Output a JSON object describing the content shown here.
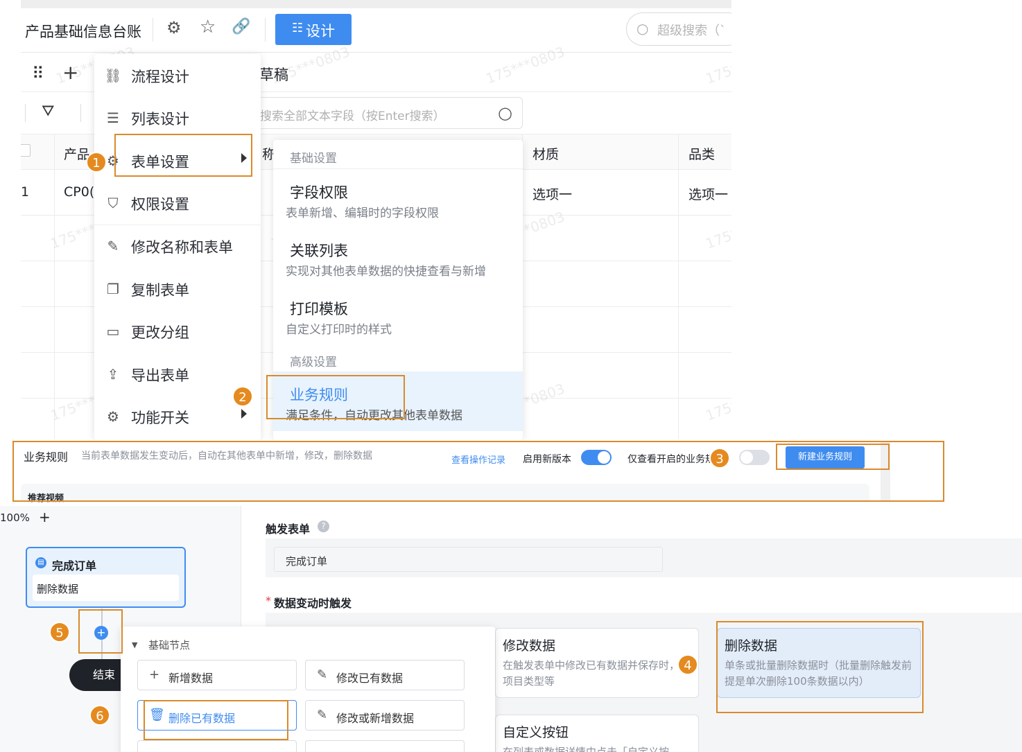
{
  "header": {
    "title": "产品基础信息台账",
    "design_button": "设计",
    "search_placeholder": "超级搜索（`"
  },
  "toolbar": {
    "draft_label": "草稿",
    "table_search_placeholder": "搜索全部文本字段（按Enter搜索）"
  },
  "table": {
    "headers": [
      "产品",
      "称",
      "材质",
      "品类"
    ],
    "row1": {
      "index": "1",
      "code": "CP0(",
      "material": "选项一",
      "category": "选项一"
    }
  },
  "watermark": "175***0803",
  "menu": {
    "items": [
      {
        "label": "流程设计",
        "icon": "flow-icon"
      },
      {
        "label": "列表设计",
        "icon": "list-icon"
      },
      {
        "label": "表单设置",
        "icon": "gear-icon"
      },
      {
        "label": "权限设置",
        "icon": "shield-icon"
      },
      {
        "label": "修改名称和表单",
        "icon": "edit-icon"
      },
      {
        "label": "复制表单",
        "icon": "copy-icon"
      },
      {
        "label": "更改分组",
        "icon": "folder-icon"
      },
      {
        "label": "导出表单",
        "icon": "export-icon"
      },
      {
        "label": "功能开关",
        "icon": "gear-icon"
      }
    ]
  },
  "submenu": {
    "basic_section": "基础设置",
    "items": [
      {
        "title": "字段权限",
        "desc": "表单新增、编辑时的字段权限"
      },
      {
        "title": "关联列表",
        "desc": "实现对其他表单数据的快捷查看与新增"
      },
      {
        "title": "打印模板",
        "desc": "自定义打印时的样式"
      }
    ],
    "advanced_section": "高级设置",
    "active_item": {
      "title": "业务规则",
      "desc": "满足条件，自动更改其他表单数据"
    }
  },
  "banner": {
    "title": "业务规则",
    "desc": "当前表单数据发生变动后，自动在其他表单中新增，修改，删除数据",
    "log_link": "查看操作记录",
    "new_version_label": "启用新版本",
    "only_enabled_label": "仅查看开启的业务规则",
    "new_rule_button": "新建业务规则",
    "recommend_video": "推荐视频"
  },
  "workflow": {
    "zoom": "100%",
    "zoom_in": "+",
    "trigger_node_title": "完成订单",
    "trigger_node_action": "删除数据",
    "end_node": "结束",
    "node_group": "基础节点",
    "node_buttons": [
      "新增数据",
      "修改已有数据",
      "删除已有数据",
      "修改或新增数据"
    ]
  },
  "config": {
    "trigger_form_label": "触发表单",
    "trigger_form_value": "完成订单",
    "trigger_when_label": "数据变动时触发",
    "required_mark": "*",
    "cards": [
      {
        "title": "修改数据",
        "desc": "在触发表单中修改已有数据并保存时，如项目类型等"
      },
      {
        "title": "删除数据",
        "desc": "单条或批量删除数据时（批量删除触发前提是单次删除100条数据以内）"
      },
      {
        "title": "自定义按钮",
        "desc": "在列表或数据详情中点击「自定义按"
      }
    ]
  },
  "steps": [
    "1",
    "2",
    "3",
    "4",
    "5",
    "6"
  ],
  "colors": {
    "primary": "#3f8cf0",
    "highlight": "#d98a2c",
    "badge": "#e58a1f"
  }
}
